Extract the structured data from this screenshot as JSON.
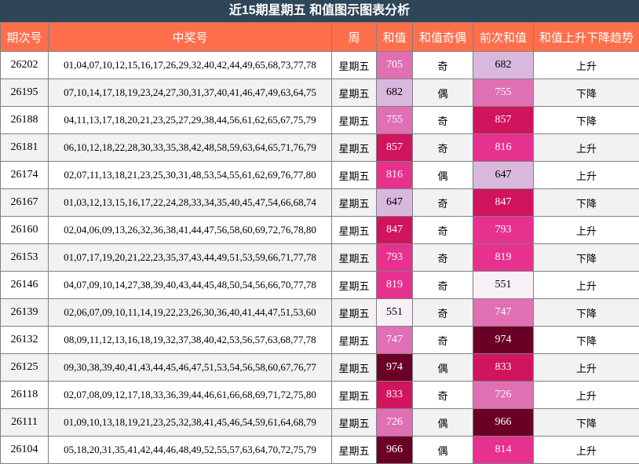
{
  "title": "近15期星期五 和值图示图表分析",
  "headers": [
    "期次号",
    "中奖号",
    "周",
    "和值",
    "和值奇偶",
    "前次和值",
    "和值上升下降趋势"
  ],
  "rows": [
    {
      "issue": "26202",
      "numbers": "01,04,07,10,12,15,16,17,26,29,32,40,42,44,49,65,68,73,77,78",
      "weekday": "星期五",
      "sum": 705,
      "parity": "奇",
      "prev_sum": 682,
      "trend": "上升"
    },
    {
      "issue": "26195",
      "numbers": "07,10,14,17,18,19,23,24,27,30,31,37,40,41,46,47,49,63,64,75",
      "weekday": "星期五",
      "sum": 682,
      "parity": "偶",
      "prev_sum": 755,
      "trend": "下降"
    },
    {
      "issue": "26188",
      "numbers": "04,11,13,17,18,20,21,23,25,27,29,38,44,56,61,62,65,67,75,79",
      "weekday": "星期五",
      "sum": 755,
      "parity": "奇",
      "prev_sum": 857,
      "trend": "下降"
    },
    {
      "issue": "26181",
      "numbers": "06,10,12,18,22,28,30,33,35,38,42,48,58,59,63,64,65,71,76,79",
      "weekday": "星期五",
      "sum": 857,
      "parity": "奇",
      "prev_sum": 816,
      "trend": "上升"
    },
    {
      "issue": "26174",
      "numbers": "02,07,11,13,18,21,23,25,30,31,48,53,54,55,61,62,69,76,77,80",
      "weekday": "星期五",
      "sum": 816,
      "parity": "偶",
      "prev_sum": 647,
      "trend": "上升"
    },
    {
      "issue": "26167",
      "numbers": "01,03,12,13,15,16,17,22,24,28,33,34,35,40,45,47,54,66,68,74",
      "weekday": "星期五",
      "sum": 647,
      "parity": "奇",
      "prev_sum": 847,
      "trend": "下降"
    },
    {
      "issue": "26160",
      "numbers": "02,04,06,09,13,26,32,36,38,41,44,47,56,58,60,69,72,76,78,80",
      "weekday": "星期五",
      "sum": 847,
      "parity": "奇",
      "prev_sum": 793,
      "trend": "上升"
    },
    {
      "issue": "26153",
      "numbers": "01,07,17,19,20,21,22,23,35,37,43,44,49,51,53,59,66,71,77,78",
      "weekday": "星期五",
      "sum": 793,
      "parity": "奇",
      "prev_sum": 819,
      "trend": "下降"
    },
    {
      "issue": "26146",
      "numbers": "04,07,09,10,14,27,38,39,40,43,44,45,48,50,54,56,66,70,77,78",
      "weekday": "星期五",
      "sum": 819,
      "parity": "奇",
      "prev_sum": 551,
      "trend": "上升"
    },
    {
      "issue": "26139",
      "numbers": "02,06,07,09,10,11,14,19,22,23,26,30,36,40,41,44,47,51,53,60",
      "weekday": "星期五",
      "sum": 551,
      "parity": "奇",
      "prev_sum": 747,
      "trend": "下降"
    },
    {
      "issue": "26132",
      "numbers": "08,09,11,12,13,16,18,19,32,37,38,40,42,53,56,57,63,68,77,78",
      "weekday": "星期五",
      "sum": 747,
      "parity": "奇",
      "prev_sum": 974,
      "trend": "下降"
    },
    {
      "issue": "26125",
      "numbers": "09,30,38,39,40,41,43,44,45,46,47,51,53,54,56,58,60,67,76,77",
      "weekday": "星期五",
      "sum": 974,
      "parity": "偶",
      "prev_sum": 833,
      "trend": "上升"
    },
    {
      "issue": "26118",
      "numbers": "02,07,08,09,12,17,18,33,36,39,44,46,61,66,68,69,71,72,75,80",
      "weekday": "星期五",
      "sum": 833,
      "parity": "奇",
      "prev_sum": 726,
      "trend": "上升"
    },
    {
      "issue": "26111",
      "numbers": "01,09,10,13,18,19,21,23,25,32,38,41,45,46,54,59,61,64,68,79",
      "weekday": "星期五",
      "sum": 726,
      "parity": "偶",
      "prev_sum": 966,
      "trend": "下降"
    },
    {
      "issue": "26104",
      "numbers": "05,18,20,31,35,41,42,44,46,48,49,52,55,57,63,64,70,72,75,79",
      "weekday": "星期五",
      "sum": 966,
      "parity": "偶",
      "prev_sum": 814,
      "trend": "上升"
    }
  ],
  "colors": {
    "title_bg": "#2f4558",
    "header_bg": "#ff6f4b",
    "row_alt_bg": "#f2f2f2",
    "heat_scale": [
      "#f7f0f7",
      "#d8b8dc",
      "#e06fb4",
      "#e7318f",
      "#d0145e",
      "#6a0026"
    ]
  }
}
